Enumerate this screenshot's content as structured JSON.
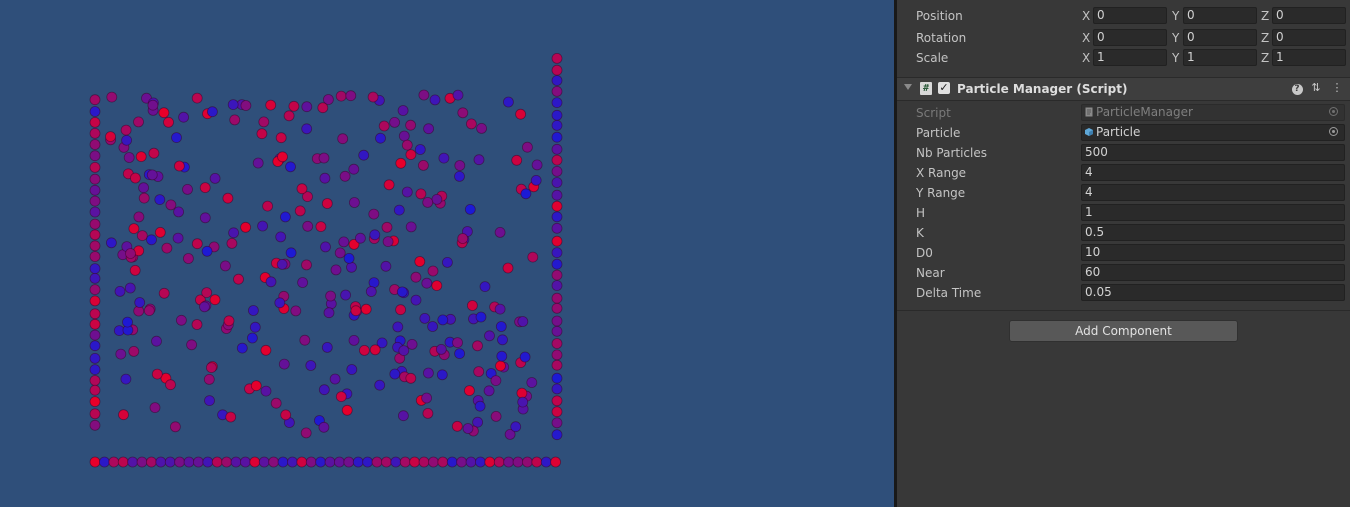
{
  "transform": {
    "rows": [
      {
        "label": "Position",
        "x": "0",
        "y": "0",
        "z": "0"
      },
      {
        "label": "Rotation",
        "x": "0",
        "y": "0",
        "z": "0"
      },
      {
        "label": "Scale",
        "x": "1",
        "y": "1",
        "z": "1"
      }
    ],
    "axis_x": "X",
    "axis_y": "Y",
    "axis_z": "Z"
  },
  "component": {
    "title": "Particle Manager (Script)",
    "enabled": true,
    "header_icon": "script-icon"
  },
  "fields": {
    "script": {
      "label": "Script",
      "value": "ParticleManager"
    },
    "particle": {
      "label": "Particle",
      "value": "Particle"
    },
    "nb_particles": {
      "label": "Nb Particles",
      "value": "500"
    },
    "x_range": {
      "label": "X Range",
      "value": "4"
    },
    "y_range": {
      "label": "Y Range",
      "value": "4"
    },
    "h": {
      "label": "H",
      "value": "1"
    },
    "k": {
      "label": "K",
      "value": "0.5"
    },
    "d0": {
      "label": "D0",
      "value": "10"
    },
    "near": {
      "label": "Near",
      "value": "60"
    },
    "delta_time": {
      "label": "Delta Time",
      "value": "0.05"
    }
  },
  "add_component_label": "Add Component",
  "colors": {
    "scene_bg": "#2f4f7a",
    "particle_red": "#e8002a",
    "particle_blue": "#1a1ad6",
    "particle_purple": "#7a1a9a",
    "particle_outline": "#4a0030"
  }
}
